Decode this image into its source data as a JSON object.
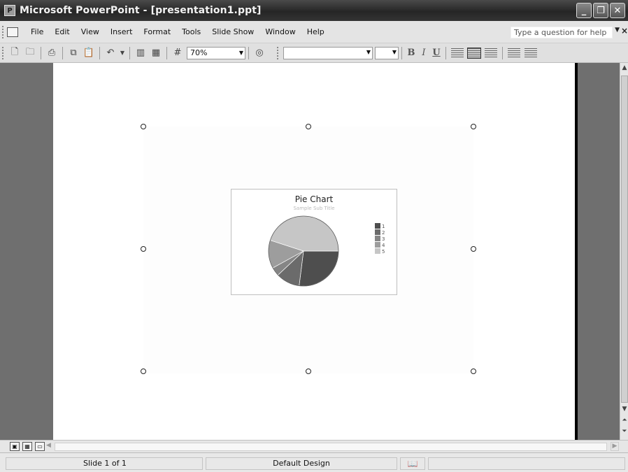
{
  "window": {
    "title": "Microsoft PowerPoint - [presentation1.ppt]",
    "controls": {
      "minimize": "_",
      "restore": "❐",
      "close": "✕"
    }
  },
  "menu": {
    "items": [
      {
        "label": "File"
      },
      {
        "label": "Edit"
      },
      {
        "label": "View"
      },
      {
        "label": "Insert"
      },
      {
        "label": "Format"
      },
      {
        "label": "Tools"
      },
      {
        "label": "Slide Show"
      },
      {
        "label": "Window"
      },
      {
        "label": "Help"
      }
    ],
    "help_placeholder": "Type a question for help",
    "close_glyph": "×"
  },
  "toolbar": {
    "zoom": "70%",
    "bold": "B",
    "italic": "I",
    "underline": "U"
  },
  "chart": {
    "title": "Pie Chart",
    "subtitle": "Sample Sub Title"
  },
  "chart_data": {
    "type": "pie",
    "title": "Pie Chart",
    "subtitle": "Sample Sub Title",
    "categories": [
      "1",
      "2",
      "3",
      "4",
      "5"
    ],
    "values": [
      27,
      11,
      4,
      13,
      45
    ],
    "colors": [
      "#4e4e4e",
      "#6b6b6b",
      "#858585",
      "#9d9d9d",
      "#c6c6c6"
    ],
    "legend_position": "right"
  },
  "statusbar": {
    "slide": "Slide 1 of 1",
    "design": "Default Design"
  }
}
